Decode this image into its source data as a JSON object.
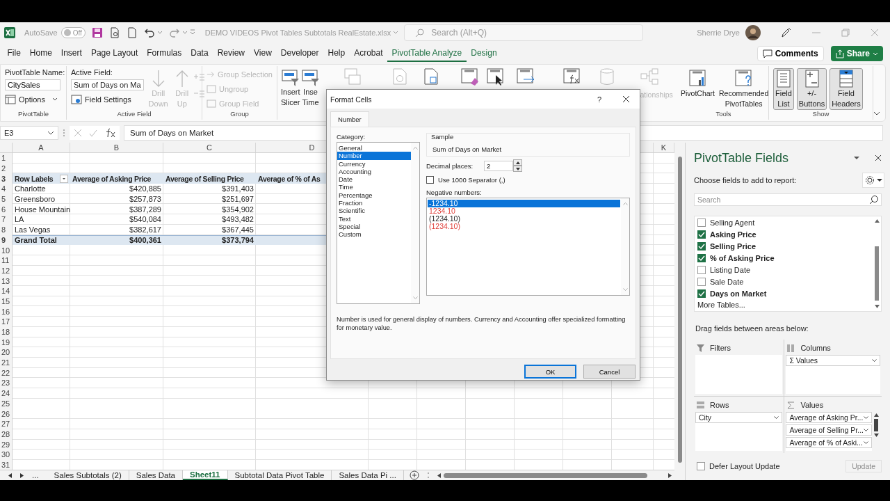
{
  "title_bar": {
    "autosave": {
      "label": "AutoSave",
      "on": false,
      "text": "Off"
    },
    "file_name": "DEMO VIDEOS Pivot Tables Subtotals RealEstate.xlsx",
    "search": {
      "placeholder": "Search (Alt+Q)"
    },
    "user": "Sherrie Drye"
  },
  "menu": {
    "tabs": [
      {
        "label": "File",
        "selected": false,
        "kind": "normal"
      },
      {
        "label": "Home",
        "selected": false,
        "kind": "normal"
      },
      {
        "label": "Insert",
        "selected": false,
        "kind": "normal"
      },
      {
        "label": "Page Layout",
        "selected": false,
        "kind": "normal"
      },
      {
        "label": "Formulas",
        "selected": false,
        "kind": "normal"
      },
      {
        "label": "Data",
        "selected": false,
        "kind": "normal"
      },
      {
        "label": "Review",
        "selected": false,
        "kind": "normal"
      },
      {
        "label": "View",
        "selected": false,
        "kind": "normal"
      },
      {
        "label": "Developer",
        "selected": false,
        "kind": "normal"
      },
      {
        "label": "Help",
        "selected": false,
        "kind": "normal"
      },
      {
        "label": "Acrobat",
        "selected": false,
        "kind": "normal"
      },
      {
        "label": "PivotTable Analyze",
        "selected": true,
        "kind": "contextual"
      },
      {
        "label": "Design",
        "selected": false,
        "kind": "contextual"
      }
    ],
    "buttons": [
      {
        "label": "Comments",
        "kind": "outline"
      },
      {
        "label": "Share",
        "kind": "primary"
      }
    ]
  },
  "ribbon": {
    "pivottable": {
      "name_label": "PivotTable Name:",
      "name_value": "CitySales",
      "options": "Options",
      "group": "PivotTable"
    },
    "active_field": {
      "label": "Active Field:",
      "value": "Sum of Days on Ma",
      "settings": "Field Settings",
      "drill": [
        {
          "lines": [
            "Drill",
            "Down"
          ],
          "disabled": true
        },
        {
          "lines": [
            "Drill",
            "Up"
          ],
          "disabled": true
        }
      ],
      "group": "Active Field"
    },
    "group": {
      "items": [
        {
          "label": "Group Selection",
          "disabled": true
        },
        {
          "label": "Ungroup",
          "disabled": true
        },
        {
          "label": "Group Field",
          "disabled": true
        }
      ],
      "group": "Group"
    },
    "filter": {
      "items": [
        {
          "lines": [
            "Insert",
            "Slicer"
          ]
        },
        {
          "lines": [
            "Inse",
            "Time"
          ]
        }
      ]
    },
    "relationships_text": "ationships",
    "tools": {
      "items": [
        {
          "lines": [
            "PivotChart"
          ]
        },
        {
          "lines": [
            "Recommended",
            "PivotTables"
          ]
        }
      ],
      "group": "Tools"
    },
    "show": {
      "items": [
        {
          "lines": [
            "Field",
            "List"
          ],
          "on": true
        },
        {
          "lines": [
            "+/-",
            "Buttons"
          ],
          "on": true
        },
        {
          "lines": [
            "Field",
            "Headers"
          ],
          "on": true
        }
      ],
      "group": "Show"
    }
  },
  "formula_bar": {
    "name_box": "E3",
    "formula": "Sum of Days on Market"
  },
  "sheet": {
    "columns_left": [
      "A",
      "B",
      "C",
      "D"
    ],
    "columns_right": [
      "K"
    ],
    "row_numbers": [
      "1",
      "2",
      "3",
      "4",
      "5",
      "6",
      "7",
      "8",
      "9",
      "10",
      "11",
      "12",
      "13",
      "14",
      "15",
      "16",
      "17",
      "18",
      "19",
      "20",
      "21",
      "22",
      "23",
      "24",
      "25",
      "26",
      "27",
      "28",
      "29",
      "30",
      "31"
    ],
    "pivot": {
      "header": [
        "Row Labels",
        "Average of Asking Price",
        "Average of Selling Price",
        "Average of % of As"
      ],
      "rows": [
        [
          "Charlotte",
          "$420,885",
          "$391,403"
        ],
        [
          "Greensboro",
          "$257,873",
          "$251,697"
        ],
        [
          "House Mountain",
          "$387,289",
          "$354,902"
        ],
        [
          "LA",
          "$540,084",
          "$493,482"
        ],
        [
          "Las Vegas",
          "$382,617",
          "$367,445"
        ]
      ],
      "total": [
        "Grand Total",
        "$400,361",
        "$373,794"
      ]
    }
  },
  "sheet_tabs": {
    "more": "...",
    "tabs": [
      {
        "label": "Sales Subtotals (2)",
        "selected": false
      },
      {
        "label": "Sales Data",
        "selected": false
      },
      {
        "label": "Sheet11",
        "selected": true
      },
      {
        "label": "Subtotal Data Pivot Table",
        "selected": false
      },
      {
        "label": "Sales Data Pi ...",
        "selected": false
      }
    ]
  },
  "dialog": {
    "title": "Format Cells",
    "help": "?",
    "tabs": [
      {
        "label": "Number",
        "selected": true
      }
    ],
    "category_label": "Category:",
    "categories": [
      {
        "label": "General",
        "selected": false
      },
      {
        "label": "Number",
        "selected": true
      },
      {
        "label": "Currency",
        "selected": false
      },
      {
        "label": "Accounting",
        "selected": false
      },
      {
        "label": "Date",
        "selected": false
      },
      {
        "label": "Time",
        "selected": false
      },
      {
        "label": "Percentage",
        "selected": false
      },
      {
        "label": "Fraction",
        "selected": false
      },
      {
        "label": "Scientific",
        "selected": false
      },
      {
        "label": "Text",
        "selected": false
      },
      {
        "label": "Special",
        "selected": false
      },
      {
        "label": "Custom",
        "selected": false
      }
    ],
    "sample_label": "Sample",
    "sample_value": "Sum of Days on Market",
    "decimal_label": "Decimal places:",
    "decimal_value": "2",
    "separator": {
      "label": "Use 1000 Separator (,)",
      "checked": false
    },
    "negative_label": "Negative numbers:",
    "negatives": [
      {
        "label": "-1234.10",
        "selected": true
      },
      {
        "label": "1234.10",
        "selected": false,
        "color": "#e0403a"
      },
      {
        "label": "(1234.10)",
        "selected": false
      },
      {
        "label": "(1234.10)",
        "selected": false,
        "color": "#e0403a"
      }
    ],
    "description": "Number is used for general display of numbers.  Currency and Accounting offer specialized formatting for monetary value.",
    "buttons": [
      {
        "label": "OK",
        "kind": "default"
      },
      {
        "label": "Cancel",
        "kind": "normal"
      }
    ]
  },
  "field_pane": {
    "title": "PivotTable Fields",
    "subtitle": "Choose fields to add to report:",
    "search": {
      "placeholder": "Search"
    },
    "fields": [
      {
        "label": "Selling Agent",
        "checked": false
      },
      {
        "label": "Asking Price",
        "checked": true
      },
      {
        "label": "Selling Price",
        "checked": true
      },
      {
        "label": "% of Asking Price",
        "checked": true
      },
      {
        "label": "Listing Date",
        "checked": false
      },
      {
        "label": "Sale Date",
        "checked": false
      },
      {
        "label": "Days on Market",
        "checked": true
      }
    ],
    "more_tables": "More Tables...",
    "drag_hint": "Drag fields between areas below:",
    "areas": [
      {
        "kind": "filters",
        "title": "Filters"
      },
      {
        "kind": "columns",
        "title": "Columns",
        "items": [
          "Σ Values"
        ]
      },
      {
        "kind": "rows",
        "title": "Rows",
        "items": [
          "City"
        ]
      },
      {
        "kind": "values",
        "title": "Values",
        "items": [
          "Average of Asking Pr...",
          "Average of Selling Pr...",
          "Average of % of Aski..."
        ]
      }
    ],
    "defer": {
      "label": "Defer Layout Update",
      "checked": false
    },
    "update": {
      "label": "Update",
      "disabled": true
    }
  }
}
